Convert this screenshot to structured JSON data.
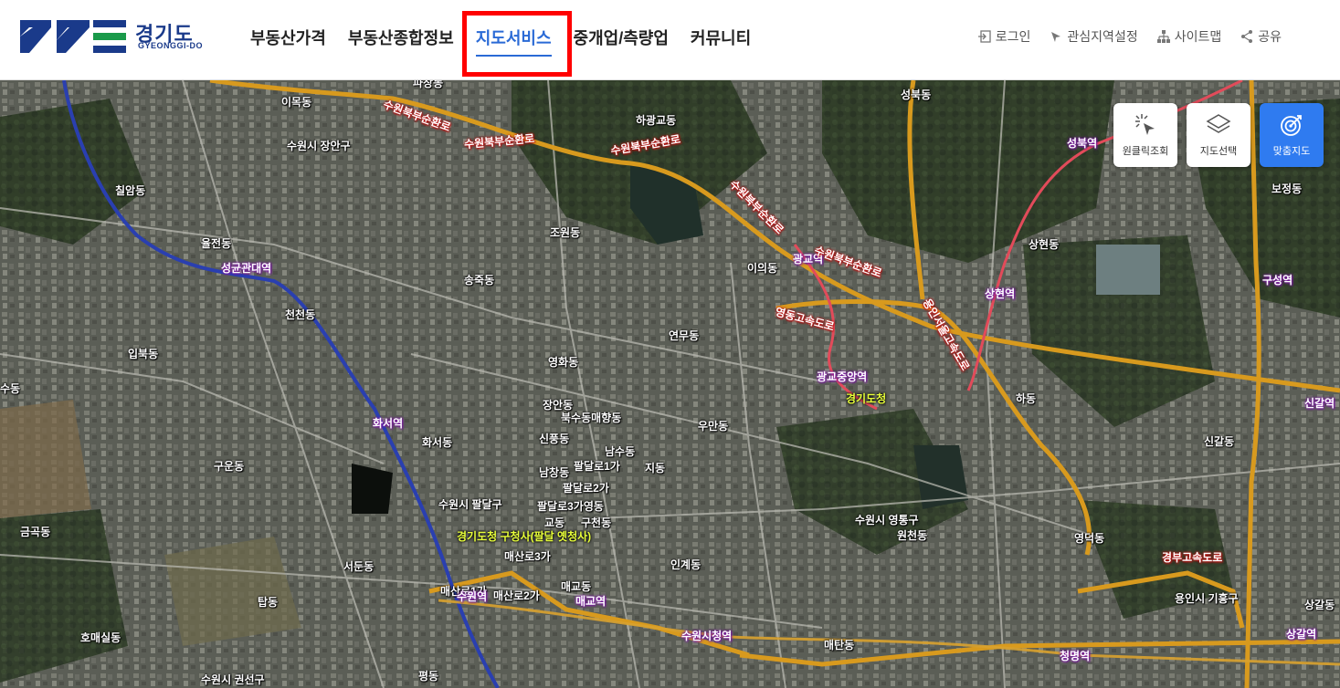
{
  "header": {
    "logo_text": "경기도",
    "logo_sub": "GYEONGGI-DO",
    "nav": [
      "부동산가격",
      "부동산종합정보",
      "지도서비스",
      "중개업/측량업",
      "커뮤니티"
    ],
    "active_nav": "지도서비스",
    "util": [
      {
        "label": "로그인",
        "icon": "login-icon"
      },
      {
        "label": "관심지역설정",
        "icon": "pin-icon"
      },
      {
        "label": "사이트맵",
        "icon": "sitemap-icon"
      },
      {
        "label": "공유",
        "icon": "share-icon"
      }
    ]
  },
  "map_controls": [
    {
      "label": "원클릭조회",
      "icon": "click-icon",
      "active": false
    },
    {
      "label": "지도선택",
      "icon": "layers-icon",
      "active": false
    },
    {
      "label": "맞춤지도",
      "icon": "target-icon",
      "active": true
    }
  ],
  "colors": {
    "accent": "#2a6ad6",
    "highlight": "#ff0000",
    "control_active": "#2f7bf0"
  },
  "map_labels": {
    "districts": [
      "파장동",
      "이목동",
      "수원시 장안구",
      "하광교동",
      "성북동",
      "칠암동",
      "조원동",
      "율전동",
      "송죽동",
      "이의동",
      "상현동",
      "보정동",
      "천천동",
      "연무동",
      "입북동",
      "영화동",
      "하동",
      "수동",
      "장안동",
      "북수동매향동",
      "우만동",
      "신갈동",
      "화서동",
      "신풍동",
      "남수동",
      "구운동",
      "남창동",
      "팔달로1가",
      "지동",
      "팔달로2가",
      "수원시 팔달구",
      "팔달로3가영동",
      "교동",
      "구천동",
      "수원시 영통구",
      "원천동",
      "금곡동",
      "매산로3가",
      "서둔동",
      "인계동",
      "영덕동",
      "매교동",
      "매산로1가",
      "매산로2가",
      "탑동",
      "용인시 기흥구",
      "상갈동",
      "호매실동",
      "매탄동",
      "평동",
      "수원시 권선구"
    ],
    "stations": [
      "성균관대역",
      "화서역",
      "수원역",
      "매교역",
      "수원시청역",
      "광교역",
      "상현역",
      "광교중앙역",
      "구성역",
      "신갈역",
      "상갈역",
      "청명역",
      "성북역"
    ],
    "roads": [
      "수원북부순환로",
      "수원북부순환로",
      "수원북부순환로",
      "수원북부순환로",
      "영동고속도로",
      "용인서울고속도로",
      "경부고속도로",
      "광교역",
      "수원북부순환로",
      "수원북부순환로"
    ],
    "landmarks": [
      "경기도청",
      "경기도청 구청사(팔달 옛청사)"
    ]
  }
}
